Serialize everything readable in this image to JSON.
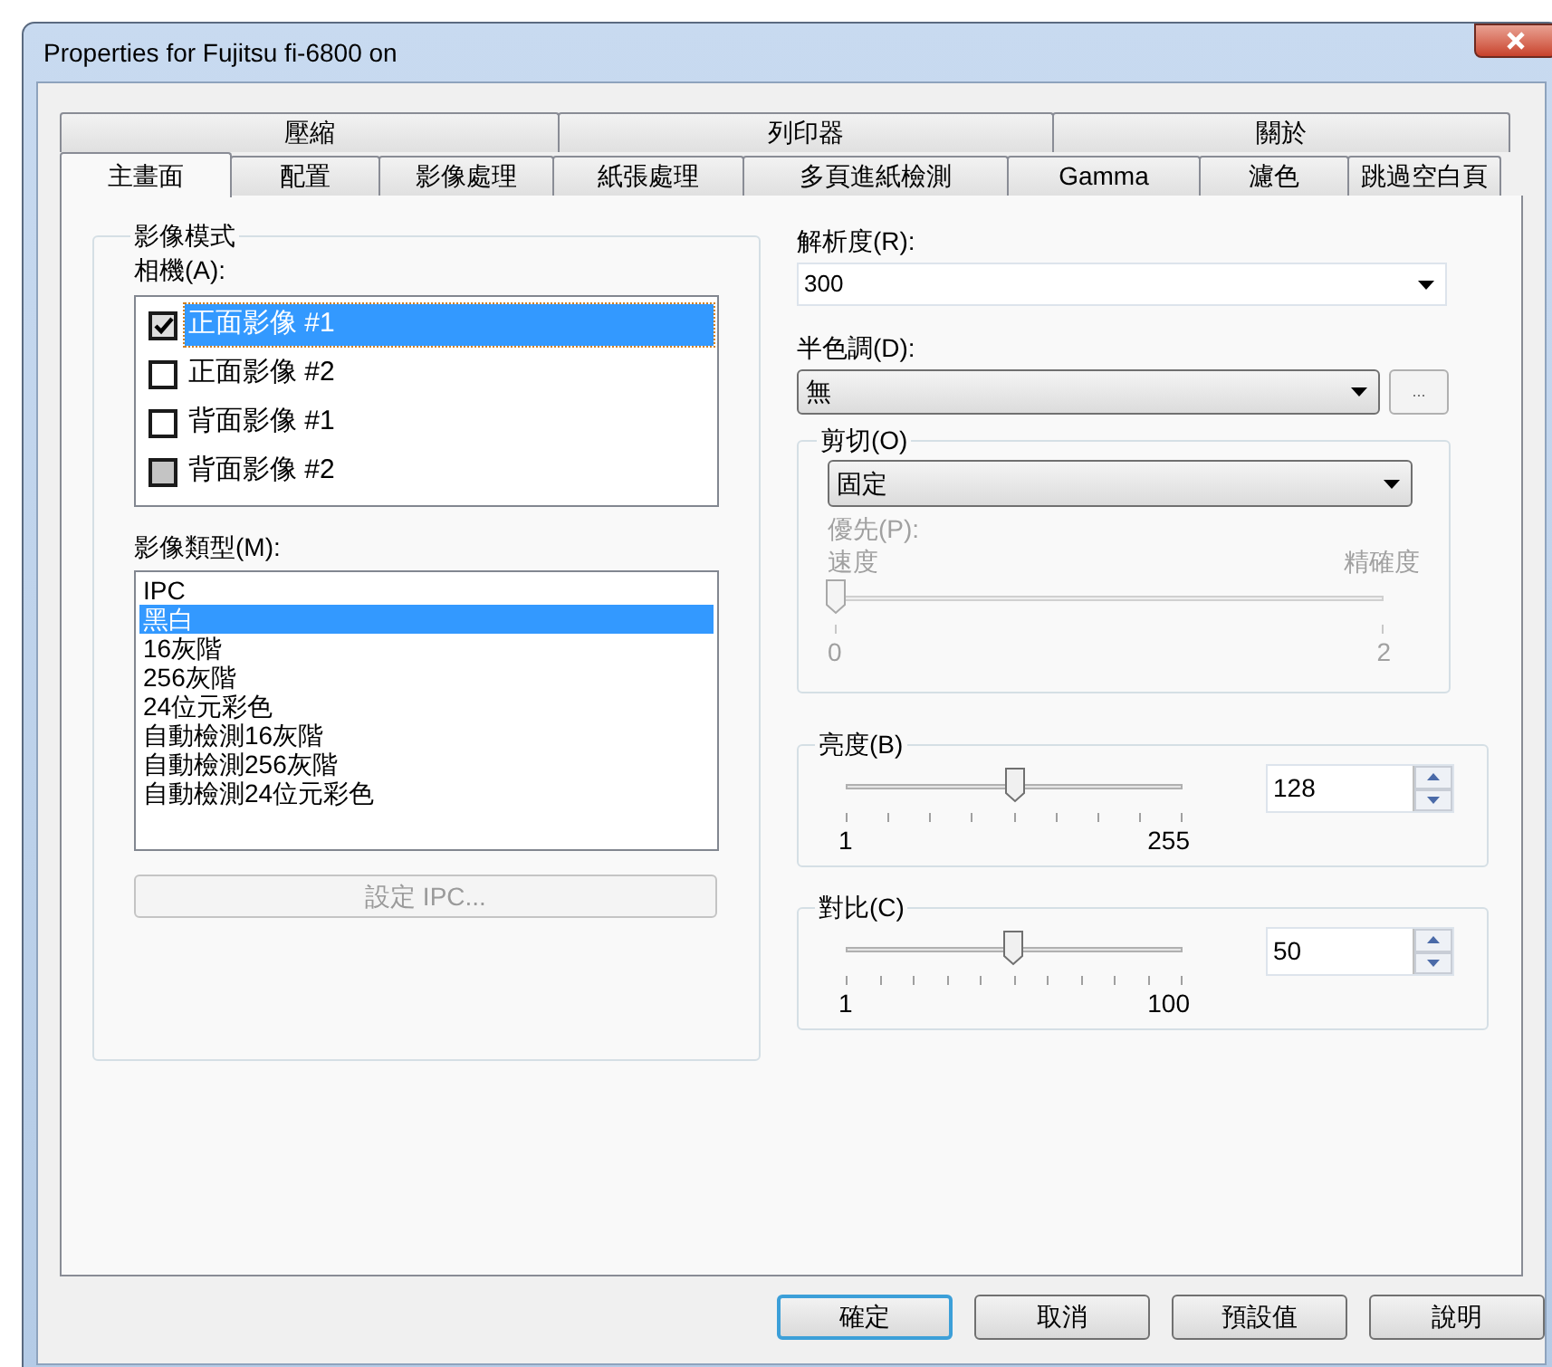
{
  "window": {
    "title": "Properties for Fujitsu fi-6800 on"
  },
  "tab_rows": [
    {
      "tabs": [
        {
          "label": "壓縮",
          "selected": false
        },
        {
          "label": "列印器",
          "selected": false
        },
        {
          "label": "關於",
          "selected": false
        }
      ]
    },
    {
      "tabs": [
        {
          "label": "主畫面",
          "selected": true
        },
        {
          "label": "配置",
          "selected": false
        },
        {
          "label": "影像處理",
          "selected": false
        },
        {
          "label": "紙張處理",
          "selected": false
        },
        {
          "label": "多頁進紙檢測",
          "selected": false
        },
        {
          "label": "Gamma",
          "selected": false
        },
        {
          "label": "濾色",
          "selected": false
        },
        {
          "label": "跳過空白頁",
          "selected": false
        }
      ]
    }
  ],
  "image_mode": {
    "title": "影像模式",
    "camera_label": "相機(A):",
    "cameras": [
      {
        "label": "正面影像 #1",
        "checked": true,
        "indeterminate": false,
        "selected": true
      },
      {
        "label": "正面影像 #2",
        "checked": false,
        "indeterminate": false,
        "selected": false
      },
      {
        "label": "背面影像 #1",
        "checked": false,
        "indeterminate": false,
        "selected": false
      },
      {
        "label": "背面影像 #2",
        "checked": false,
        "indeterminate": true,
        "selected": false
      }
    ],
    "type_label": "影像類型(M):",
    "types": [
      {
        "label": "IPC",
        "selected": false
      },
      {
        "label": "黑白",
        "selected": true
      },
      {
        "label": "16灰階",
        "selected": false
      },
      {
        "label": "256灰階",
        "selected": false
      },
      {
        "label": "24位元彩色",
        "selected": false
      },
      {
        "label": "自動檢測16灰階",
        "selected": false
      },
      {
        "label": "自動檢測256灰階",
        "selected": false
      },
      {
        "label": "自動檢測24位元彩色",
        "selected": false
      }
    ],
    "ipc_button": {
      "label": "設定 IPC...",
      "disabled": true
    }
  },
  "resolution": {
    "label": "解析度(R):",
    "value": "300"
  },
  "halftone": {
    "label": "半色調(D):",
    "value": "無",
    "more_button": "..."
  },
  "cropping": {
    "title": "剪切(O)",
    "value": "固定",
    "priority_disabled": true,
    "priority_label": "優先(P):",
    "min_label": "速度",
    "max_label": "精確度",
    "level": 0,
    "tick_labels": [
      "0",
      "2"
    ]
  },
  "adjustments": [
    {
      "title": "亮度(B)",
      "level": 0.5,
      "min_label": "1",
      "max_label": "255",
      "value": "128"
    },
    {
      "title": "對比(C)",
      "level": 0.495,
      "min_label": "1",
      "max_label": "100",
      "value": "50"
    }
  ],
  "buttons": [
    {
      "label": "確定",
      "default": true
    },
    {
      "label": "取消",
      "default": false
    },
    {
      "label": "預設值",
      "default": false
    },
    {
      "label": "說明",
      "default": false
    }
  ]
}
